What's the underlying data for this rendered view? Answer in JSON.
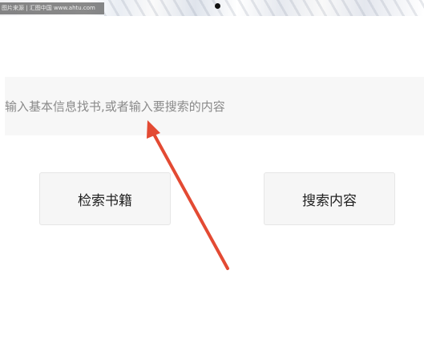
{
  "status_bar": {
    "watermark_text": "图片来源 | 汇图中国 www.ahtu.com"
  },
  "search": {
    "placeholder": "输入基本信息找书,或者输入要搜索的内容",
    "value": ""
  },
  "buttons": {
    "search_books_label": "检索书籍",
    "search_content_label": "搜索内容"
  },
  "annotation": {
    "arrow_color": "#e34a33"
  }
}
